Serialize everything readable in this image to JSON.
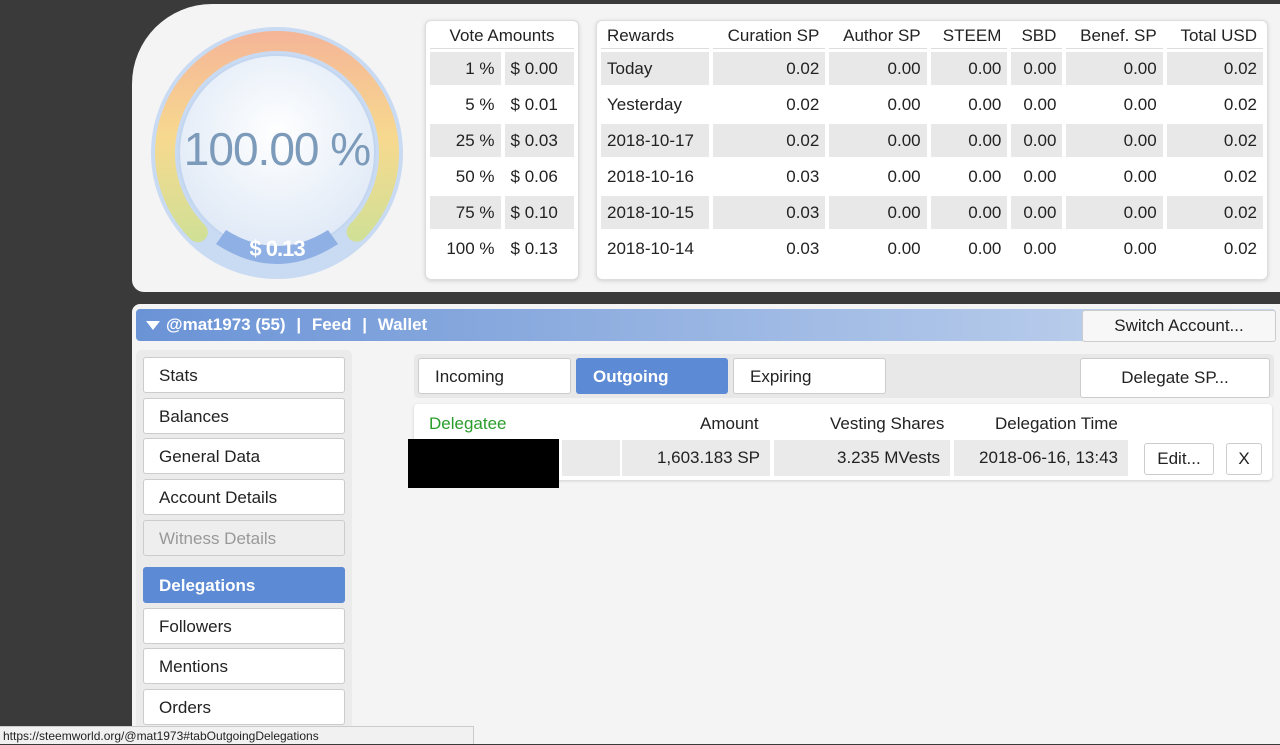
{
  "gauge": {
    "percent_text": "100.00 %",
    "usd_text": "$ 0.13",
    "level": 1.0
  },
  "vote_amounts": {
    "header": "Vote Amounts",
    "rows": [
      {
        "pct": "1 %",
        "usd": "$ 0.00"
      },
      {
        "pct": "5 %",
        "usd": "$ 0.01"
      },
      {
        "pct": "25 %",
        "usd": "$ 0.03"
      },
      {
        "pct": "50 %",
        "usd": "$ 0.06"
      },
      {
        "pct": "75 %",
        "usd": "$ 0.10"
      },
      {
        "pct": "100 %",
        "usd": "$ 0.13"
      }
    ]
  },
  "rewards": {
    "headers": [
      "Rewards",
      "Curation SP",
      "Author SP",
      "STEEM",
      "SBD",
      "Benef. SP",
      "Total USD"
    ],
    "rows": [
      [
        "Today",
        "0.02",
        "0.00",
        "0.00",
        "0.00",
        "0.00",
        "0.02"
      ],
      [
        "Yesterday",
        "0.02",
        "0.00",
        "0.00",
        "0.00",
        "0.00",
        "0.02"
      ],
      [
        "2018-10-17",
        "0.02",
        "0.00",
        "0.00",
        "0.00",
        "0.00",
        "0.02"
      ],
      [
        "2018-10-16",
        "0.03",
        "0.00",
        "0.00",
        "0.00",
        "0.00",
        "0.02"
      ],
      [
        "2018-10-15",
        "0.03",
        "0.00",
        "0.00",
        "0.00",
        "0.00",
        "0.02"
      ],
      [
        "2018-10-14",
        "0.03",
        "0.00",
        "0.00",
        "0.00",
        "0.00",
        "0.02"
      ]
    ]
  },
  "account_bar": {
    "account": "@mat1973 (55)",
    "separator": "|",
    "feed": "Feed",
    "wallet": "Wallet",
    "switch_label": "Switch Account..."
  },
  "menu": {
    "items": [
      {
        "label": "Stats"
      },
      {
        "label": "Balances"
      },
      {
        "label": "General Data"
      },
      {
        "label": "Account Details"
      },
      {
        "label": "Witness Details"
      },
      {
        "label": "Delegations"
      },
      {
        "label": "Followers"
      },
      {
        "label": "Mentions"
      },
      {
        "label": "Orders"
      }
    ]
  },
  "delegations": {
    "tabs": [
      {
        "label": "Incoming"
      },
      {
        "label": "Outgoing"
      },
      {
        "label": "Expiring"
      }
    ],
    "delegate_label": "Delegate SP...",
    "headers": {
      "delegatee": "Delegatee",
      "amount": "Amount",
      "vesting": "Vesting Shares",
      "time": "Delegation Time"
    },
    "row": {
      "amount": "1,603.183 SP",
      "vesting": "3.235 MVests",
      "time": "2018-06-16, 13:43",
      "edit_label": "Edit...",
      "remove_label": "X"
    }
  },
  "status_url": "https://steemworld.org/@mat1973#tabOutgoingDelegations",
  "colors": {
    "accent": "#5d8ad4",
    "delegatee_header": "#2a9d2a",
    "background": "#3a3a3a"
  }
}
